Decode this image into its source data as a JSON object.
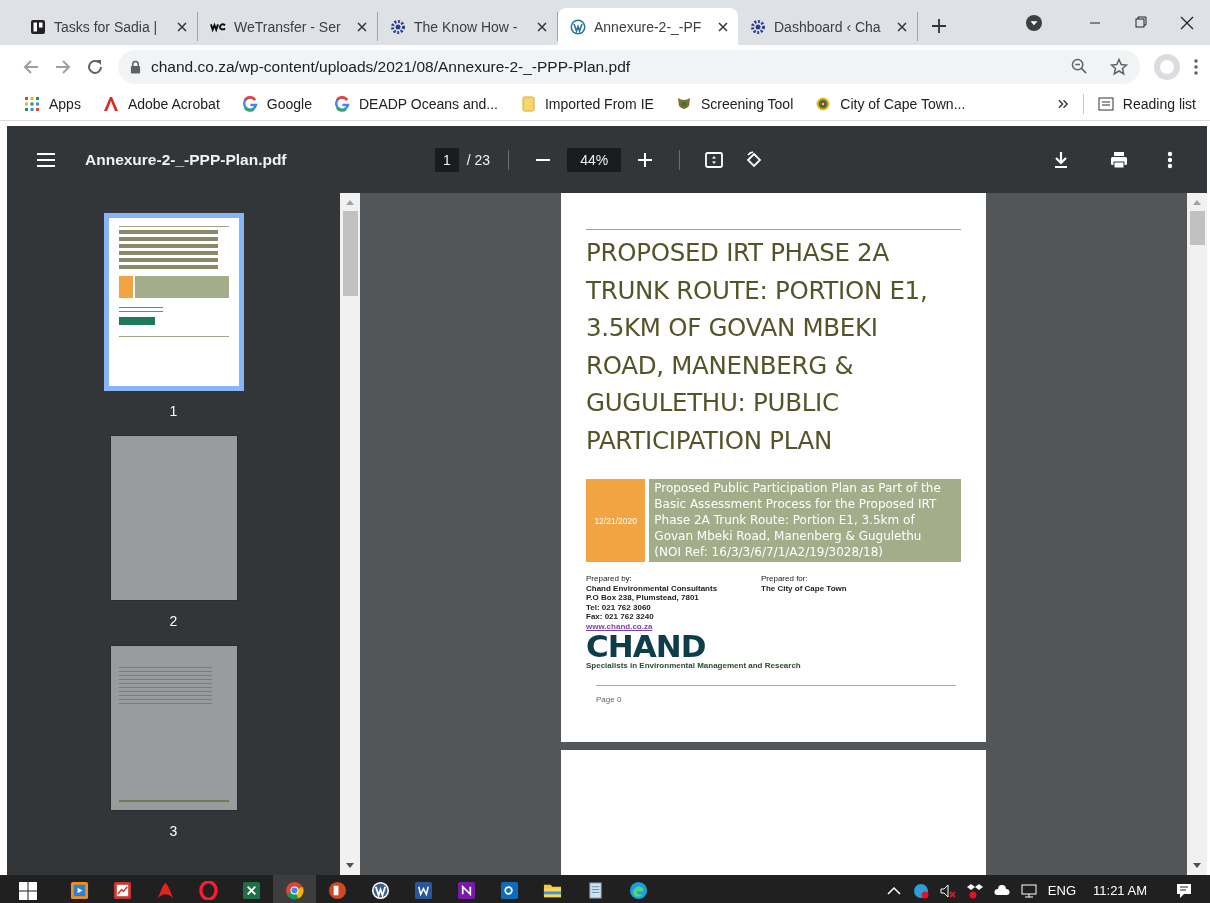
{
  "browser": {
    "tabs": [
      {
        "title": "Tasks for Sadia |",
        "selected": false
      },
      {
        "title": "WeTransfer - Ser",
        "selected": false
      },
      {
        "title": "The Know How -",
        "selected": false
      },
      {
        "title": "Annexure-2-_-PF",
        "selected": true
      },
      {
        "title": "Dashboard ‹ Cha",
        "selected": false
      }
    ],
    "address": "chand.co.za/wp-content/uploads/2021/08/Annexure-2-_-PPP-Plan.pdf",
    "bookmarks": [
      {
        "label": "Apps"
      },
      {
        "label": "Adobe Acrobat"
      },
      {
        "label": "Google"
      },
      {
        "label": "DEADP Oceans and..."
      },
      {
        "label": "Imported From IE"
      },
      {
        "label": "Screening Tool"
      },
      {
        "label": "City of Cape Town..."
      }
    ],
    "reading_list": "Reading list"
  },
  "pdf_toolbar": {
    "file_name": "Annexure-2-_-PPP-Plan.pdf",
    "page": "1",
    "page_total": "/ 23",
    "zoom": "44%"
  },
  "thumbnails": [
    {
      "number": "1",
      "selected": true,
      "kind": "cover"
    },
    {
      "number": "2",
      "selected": false,
      "kind": "blank"
    },
    {
      "number": "3",
      "selected": false,
      "kind": "contents"
    }
  ],
  "document": {
    "title": "PROPOSED IRT PHASE 2A TRUNK ROUTE: PORTION E1, 3.5KM OF GOVAN MBEKI ROAD, MANENBERG & GUGULETHU: PUBLIC PARTICIPATION PLAN",
    "date": "12/21/2020",
    "subtitle": "Proposed Public Participation Plan as Part of the Basic Assessment Process for the Proposed IRT Phase 2A Trunk Route: Portion E1, 3.5km of Govan Mbeki Road, Manenberg & Gugulethu (NOI Ref: 16/3/3/6/7/1/A2/19/3028/18)",
    "prepared_by": {
      "heading": "Prepared by:",
      "lines": [
        "Chand Environmental Consultants",
        "P.O Box 238, Plumstead, 7801",
        "Tel: 021 762 3060",
        "Fax: 021 762 3240"
      ],
      "link": "www.chand.co.za"
    },
    "prepared_for": {
      "heading": "Prepared for:",
      "lines": [
        "The City of Cape Town"
      ]
    },
    "logo": "CHAND",
    "logo_tagline": "Specialists in Environmental Management and Research",
    "footer": "Page 0"
  },
  "taskbar": {
    "apps": [
      {
        "selected": false
      },
      {
        "selected": false
      },
      {
        "selected": false
      },
      {
        "selected": false
      },
      {
        "selected": false
      },
      {
        "selected": true
      },
      {
        "selected": false
      },
      {
        "selected": false
      },
      {
        "selected": false
      },
      {
        "selected": false
      },
      {
        "selected": false
      },
      {
        "selected": false
      },
      {
        "selected": false
      },
      {
        "selected": false
      }
    ],
    "language": "ENG",
    "time": "11:21 AM"
  }
}
